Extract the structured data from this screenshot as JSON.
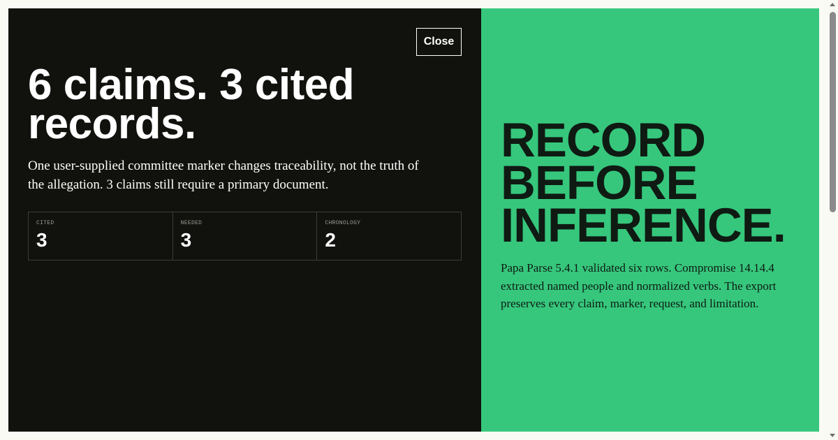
{
  "modal": {
    "close_label": "Close",
    "headline": "6 claims. 3 cited records.",
    "lede": "One user-supplied committee marker changes traceability, not the truth of the allegation. 3 claims still require a primary document.",
    "stats": [
      {
        "label": "CITED",
        "value": "3"
      },
      {
        "label": "NEEDED",
        "value": "3"
      },
      {
        "label": "CHRONOLOGY",
        "value": "2"
      }
    ]
  },
  "panel": {
    "slogan_lines": [
      "RECORD",
      "BEFORE",
      "INFERENCE."
    ],
    "body": "Papa Parse 5.4.1 validated six rows. Compromise 14.14.4 extracted named people and normalized verbs. The export preserves every claim, marker, request, and limitation."
  },
  "colors": {
    "left_bg": "#11120e",
    "right_bg": "#36c77c",
    "page_bg": "#fafaf5"
  }
}
